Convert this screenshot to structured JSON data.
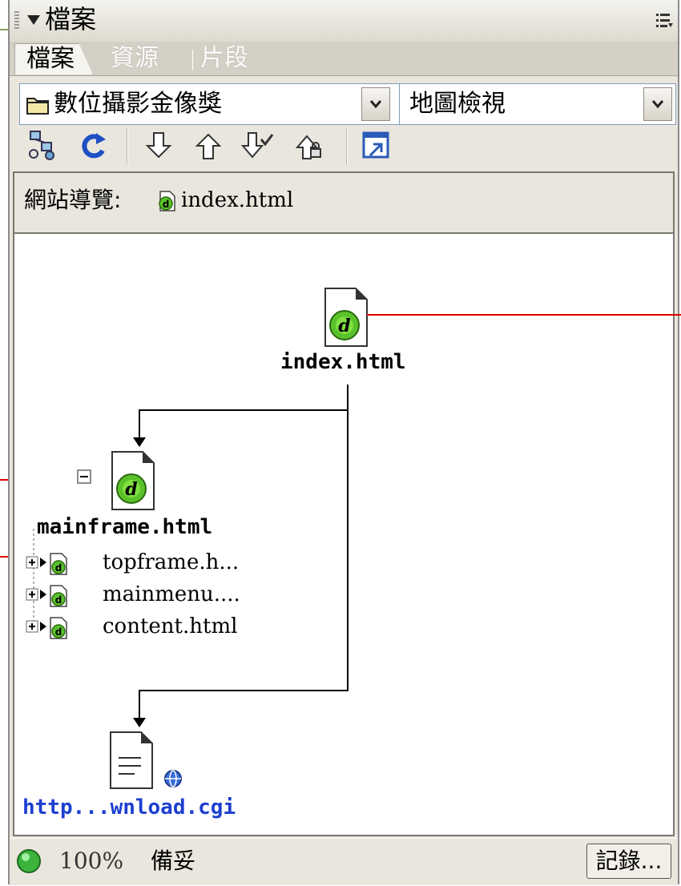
{
  "panel": {
    "title": "檔案",
    "tabs": [
      {
        "label": "檔案",
        "active": true
      },
      {
        "label": "資源",
        "active": false
      },
      {
        "label": "片段",
        "active": false
      }
    ]
  },
  "site_select": {
    "value": "數位攝影金像獎"
  },
  "view_select": {
    "value": "地圖檢視"
  },
  "toolbar": {
    "icons": [
      "connect-icon",
      "refresh-icon",
      "get-icon",
      "put-icon",
      "check-out-icon",
      "check-in-icon",
      "expand-icon"
    ]
  },
  "site_nav": {
    "label": "網站導覽:",
    "file": "index.html"
  },
  "site_map": {
    "root": "index.html",
    "child": "mainframe.html",
    "children_of_child": [
      "topframe.h...",
      "mainmenu....",
      "content.html"
    ],
    "link": "http...wnload.cgi"
  },
  "status": {
    "zoom": "100%",
    "text": "備妥",
    "log_button": "記錄...",
    "indicator_color": "#3cb43c"
  },
  "colors": {
    "annotation_line": "#e00000",
    "link_text": "#1c3fd0"
  }
}
